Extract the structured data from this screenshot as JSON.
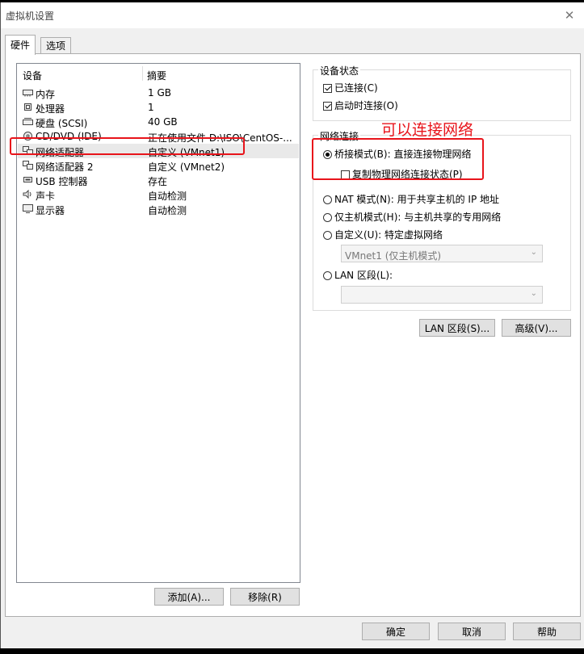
{
  "window": {
    "title": "虚拟机设置",
    "close_glyph": "✕"
  },
  "tabs": [
    {
      "label": "硬件"
    },
    {
      "label": "选项"
    }
  ],
  "device_list": {
    "headers": {
      "device": "设备",
      "summary": "摘要"
    },
    "rows": [
      {
        "name": "内存",
        "summary": "1 GB",
        "icon": "memory-icon"
      },
      {
        "name": "处理器",
        "summary": "1",
        "icon": "processor-icon"
      },
      {
        "name": "硬盘 (SCSI)",
        "summary": "40 GB",
        "icon": "harddisk-icon"
      },
      {
        "name": "CD/DVD (IDE)",
        "summary": "正在使用文件 D:\\ISO\\CentOS-...",
        "icon": "cdrom-icon"
      },
      {
        "name": "网络适配器",
        "summary": "自定义 (VMnet1)",
        "icon": "network-adapter-icon"
      },
      {
        "name": "网络适配器 2",
        "summary": "自定义 (VMnet2)",
        "icon": "network-adapter-icon"
      },
      {
        "name": "USB 控制器",
        "summary": "存在",
        "icon": "usb-icon"
      },
      {
        "name": "声卡",
        "summary": "自动检测",
        "icon": "sound-icon"
      },
      {
        "name": "显示器",
        "summary": "自动检测",
        "icon": "display-icon"
      }
    ],
    "selected_index": 4
  },
  "buttons": {
    "add": "添加(A)...",
    "remove": "移除(R)",
    "lan_segments": "LAN 区段(S)...",
    "advanced": "高级(V)...",
    "ok": "确定",
    "cancel": "取消",
    "help": "帮助"
  },
  "device_status": {
    "title": "设备状态",
    "connected": {
      "label": "已连接(C)",
      "checked": true
    },
    "connect_at_power_on": {
      "label": "启动时连接(O)",
      "checked": true
    }
  },
  "network_connection": {
    "title": "网络连接",
    "options": [
      {
        "label": "桥接模式(B): 直接连接物理网络",
        "selected": true
      },
      {
        "label": "NAT 模式(N): 用于共享主机的 IP 地址",
        "selected": false
      },
      {
        "label": "仅主机模式(H): 与主机共享的专用网络",
        "selected": false
      },
      {
        "label": "自定义(U): 特定虚拟网络",
        "selected": false
      },
      {
        "label": "LAN 区段(L):",
        "selected": false
      }
    ],
    "replicate_state": {
      "label": "复制物理网络连接状态(P)",
      "checked": false
    },
    "custom_select_value": "VMnet1 (仅主机模式)",
    "lan_select_value": ""
  },
  "annotation": {
    "text": "可以连接网络",
    "color": "#e8141b"
  }
}
